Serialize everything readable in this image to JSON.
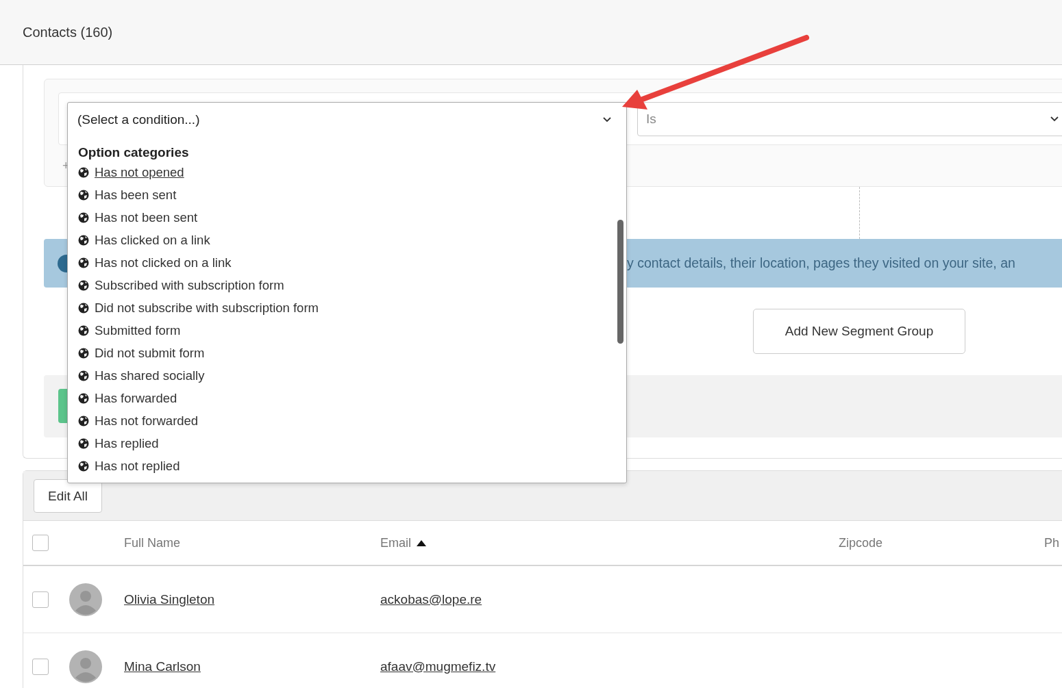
{
  "page_header": {
    "title": "Contacts (160)"
  },
  "segment_builder": {
    "condition_select": {
      "value": "(Select a condition...)",
      "expanded": true,
      "dropdown": {
        "heading": "Option categories",
        "options": [
          {
            "label": "Has not opened",
            "hovered": true
          },
          {
            "label": "Has been sent",
            "hovered": false
          },
          {
            "label": "Has not been sent",
            "hovered": false
          },
          {
            "label": "Has clicked on a link",
            "hovered": false
          },
          {
            "label": "Has not clicked on a link",
            "hovered": false
          },
          {
            "label": "Subscribed with subscription form",
            "hovered": false
          },
          {
            "label": "Did not subscribe with subscription form",
            "hovered": false
          },
          {
            "label": "Submitted form",
            "hovered": false
          },
          {
            "label": "Did not submit form",
            "hovered": false
          },
          {
            "label": "Has shared socially",
            "hovered": false
          },
          {
            "label": "Has forwarded",
            "hovered": false
          },
          {
            "label": "Has not forwarded",
            "hovered": false
          },
          {
            "label": "Has replied",
            "hovered": false
          },
          {
            "label": "Has not replied",
            "hovered": false
          }
        ]
      }
    },
    "operator_select": {
      "value": "Is"
    },
    "add_condition": "+",
    "info_banner": {
      "text": "y contact details, their location, pages they visited on your site, an"
    },
    "add_group_button": "Add New Segment Group"
  },
  "table": {
    "toolbar": {
      "edit_all_button": "Edit All"
    },
    "select_all": {
      "checked": false
    },
    "columns": [
      {
        "label": "Full Name",
        "sorted_ascending": false
      },
      {
        "label": "Email",
        "sorted_ascending": true
      },
      {
        "label": "Zipcode",
        "sorted_ascending": false
      },
      {
        "label": "Ph",
        "sorted_ascending": false
      }
    ],
    "rows": [
      {
        "name": "Olivia Singleton",
        "email": "ackobas@lope.re",
        "checked": false
      },
      {
        "name": "Mina Carlson",
        "email": "afaav@mugmefiz.tv",
        "checked": false
      }
    ]
  }
}
